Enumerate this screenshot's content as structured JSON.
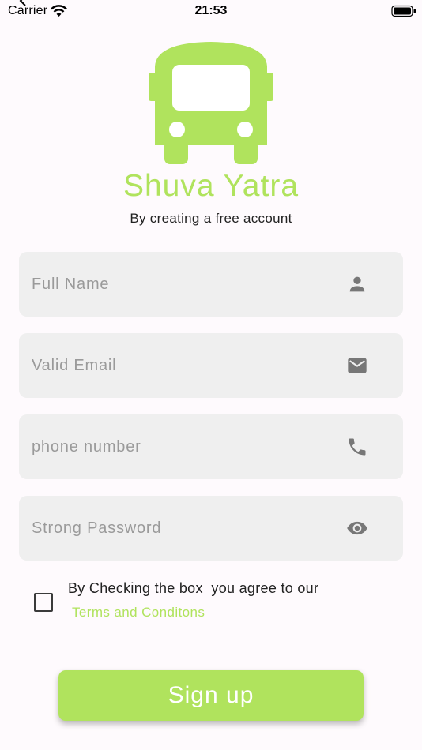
{
  "status_bar": {
    "carrier": "Carrier",
    "time": "21:53"
  },
  "app": {
    "title": "Shuva Yatra",
    "subtitle": "By creating a free account",
    "brand_color": "#b0e35d",
    "logo_icon": "bus-icon"
  },
  "form": {
    "full_name": {
      "placeholder": "Full Name",
      "value": "",
      "icon": "person-icon"
    },
    "email": {
      "placeholder": "Valid Email",
      "value": "",
      "icon": "mail-icon"
    },
    "phone": {
      "placeholder": "phone number",
      "value": "",
      "icon": "phone-icon"
    },
    "password": {
      "placeholder": "Strong Password",
      "value": "",
      "icon": "eye-icon"
    }
  },
  "agreement": {
    "text": "By Checking the box  you agree to our",
    "link": "Terms and Conditons",
    "checked": false
  },
  "signup_label": "Sign up"
}
